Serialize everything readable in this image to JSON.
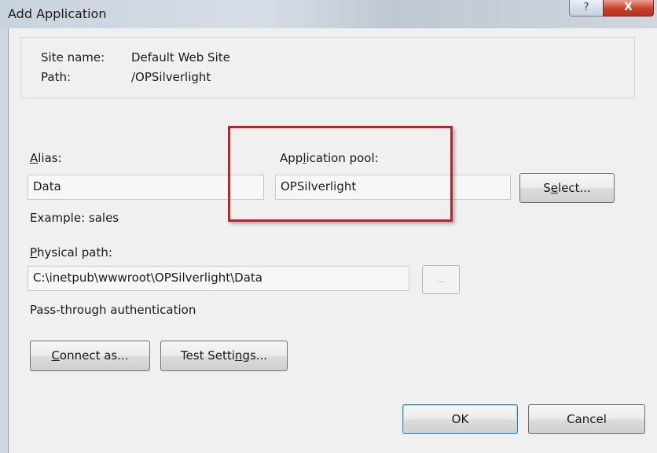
{
  "window": {
    "title": "Add Application",
    "help_glyph": "?",
    "close_glyph": "X"
  },
  "info": {
    "site_name_label": "Site name:",
    "site_name_value": "Default Web Site",
    "path_label": "Path:",
    "path_value": "/OPSilverlight"
  },
  "alias": {
    "label_ul": "A",
    "label_rest": "lias:",
    "value": "Data",
    "example": "Example: sales"
  },
  "app_pool": {
    "label_pre": "App",
    "label_ul": "l",
    "label_post": "ication pool:",
    "value": "OPSilverlight",
    "select_pre": "S",
    "select_ul": "e",
    "select_post": "lect..."
  },
  "physical_path": {
    "label_ul": "P",
    "label_rest": "hysical path:",
    "value": "C:\\inetpub\\wwwroot\\OPSilverlight\\Data",
    "browse_label": "..."
  },
  "auth": {
    "text": "Pass-through authentication"
  },
  "buttons": {
    "connect_ul": "C",
    "connect_rest": "onnect as...",
    "test_pre": "Test Setti",
    "test_ul": "n",
    "test_post": "gs...",
    "ok": "OK",
    "cancel": "Cancel"
  },
  "colors": {
    "highlight": "#c0212a",
    "close_button": "#c6412b",
    "default_button_border": "#3c7fb1"
  }
}
